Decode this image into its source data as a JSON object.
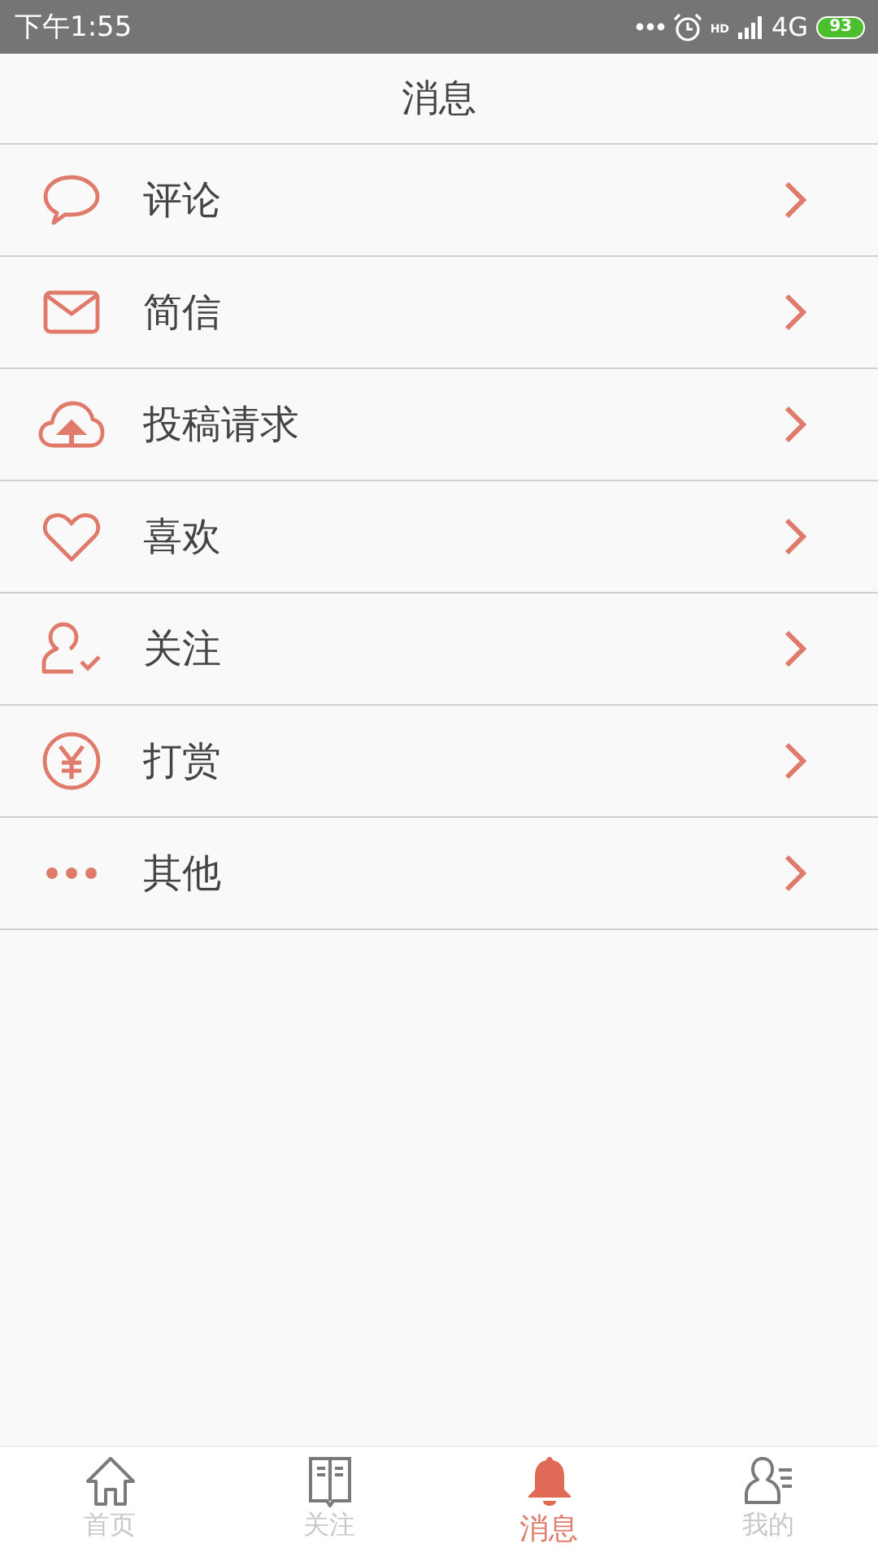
{
  "status_bar": {
    "time": "下午1:55",
    "hd": "HD",
    "network": "4G",
    "battery": "93"
  },
  "header": {
    "title": "消息"
  },
  "items": [
    {
      "kind": "comment",
      "label": "评论"
    },
    {
      "kind": "mail",
      "label": "简信"
    },
    {
      "kind": "upload",
      "label": "投稿请求"
    },
    {
      "kind": "heart",
      "label": "喜欢"
    },
    {
      "kind": "follow",
      "label": "关注"
    },
    {
      "kind": "reward",
      "label": "打赏"
    },
    {
      "kind": "more",
      "label": "其他"
    }
  ],
  "tabs": [
    {
      "kind": "home",
      "label": "首页",
      "selected": false
    },
    {
      "kind": "book",
      "label": "关注",
      "selected": false
    },
    {
      "kind": "bell",
      "label": "消息",
      "selected": true
    },
    {
      "kind": "profile",
      "label": "我的",
      "selected": false
    }
  ]
}
